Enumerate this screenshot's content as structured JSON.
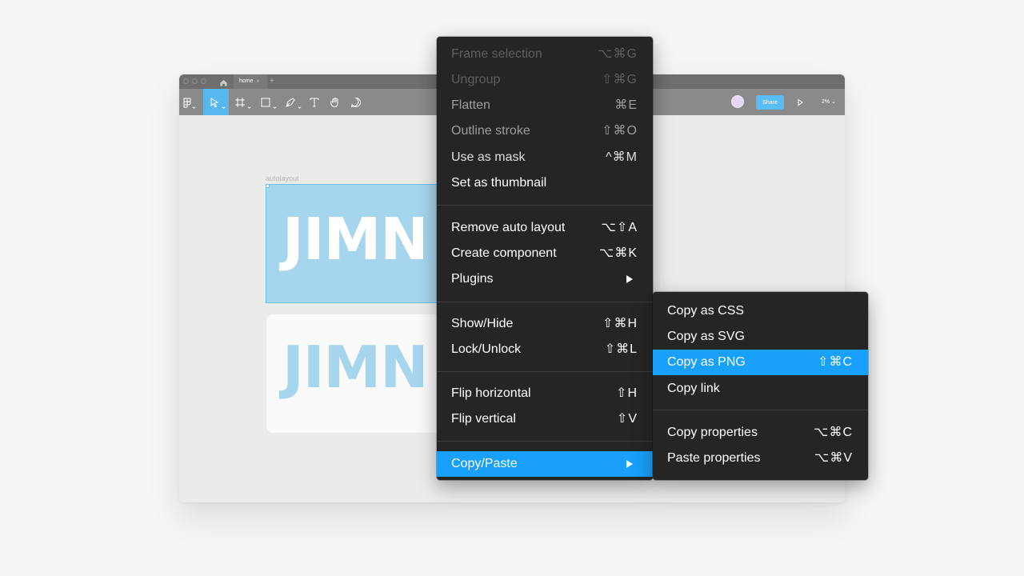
{
  "window": {
    "tab_label": "home",
    "tab_close": "×",
    "tab_add": "+",
    "share_label": "Share",
    "zoom_label": "2% ⌄"
  },
  "canvas": {
    "frame_label": "autolayout",
    "frame_text": "JIMN",
    "frame_text_2": "JIMN"
  },
  "main_menu": {
    "items": [
      {
        "label": "Frame selection",
        "shortcut": "⌥⌘G"
      },
      {
        "label": "Ungroup",
        "shortcut": "⇧⌘G"
      },
      {
        "label": "Flatten",
        "shortcut": "⌘E"
      },
      {
        "label": "Outline stroke",
        "shortcut": "⇧⌘O"
      },
      {
        "label": "Use as mask",
        "shortcut": "^⌘M"
      },
      {
        "label": "Set as thumbnail",
        "shortcut": ""
      },
      {
        "label": "Remove auto layout",
        "shortcut": "⌥⇧A"
      },
      {
        "label": "Create component",
        "shortcut": "⌥⌘K"
      },
      {
        "label": "Plugins",
        "shortcut": ""
      },
      {
        "label": "Show/Hide",
        "shortcut": "⇧⌘H"
      },
      {
        "label": "Lock/Unlock",
        "shortcut": "⇧⌘L"
      },
      {
        "label": "Flip horizontal",
        "shortcut": "⇧H"
      },
      {
        "label": "Flip vertical",
        "shortcut": "⇧V"
      },
      {
        "label": "Copy/Paste",
        "shortcut": ""
      }
    ]
  },
  "sub_menu": {
    "items": [
      {
        "label": "Copy as CSS",
        "shortcut": ""
      },
      {
        "label": "Copy as SVG",
        "shortcut": ""
      },
      {
        "label": "Copy as PNG",
        "shortcut": "⇧⌘C"
      },
      {
        "label": "Copy link",
        "shortcut": ""
      },
      {
        "label": "Copy properties",
        "shortcut": "⌥⌘C"
      },
      {
        "label": "Paste properties",
        "shortcut": "⌥⌘V"
      }
    ]
  },
  "colors": {
    "highlight": "#18a0fb",
    "menu_bg": "#252525",
    "frame_fill": "#a6d5ee",
    "share_button": "#58bdf5"
  },
  "icons": [
    "home-icon",
    "figma-menu-icon",
    "move-tool-icon",
    "frame-tool-icon",
    "rectangle-tool-icon",
    "pen-tool-icon",
    "text-tool-icon",
    "hand-tool-icon",
    "comment-tool-icon",
    "play-icon",
    "submenu-arrow-icon"
  ]
}
